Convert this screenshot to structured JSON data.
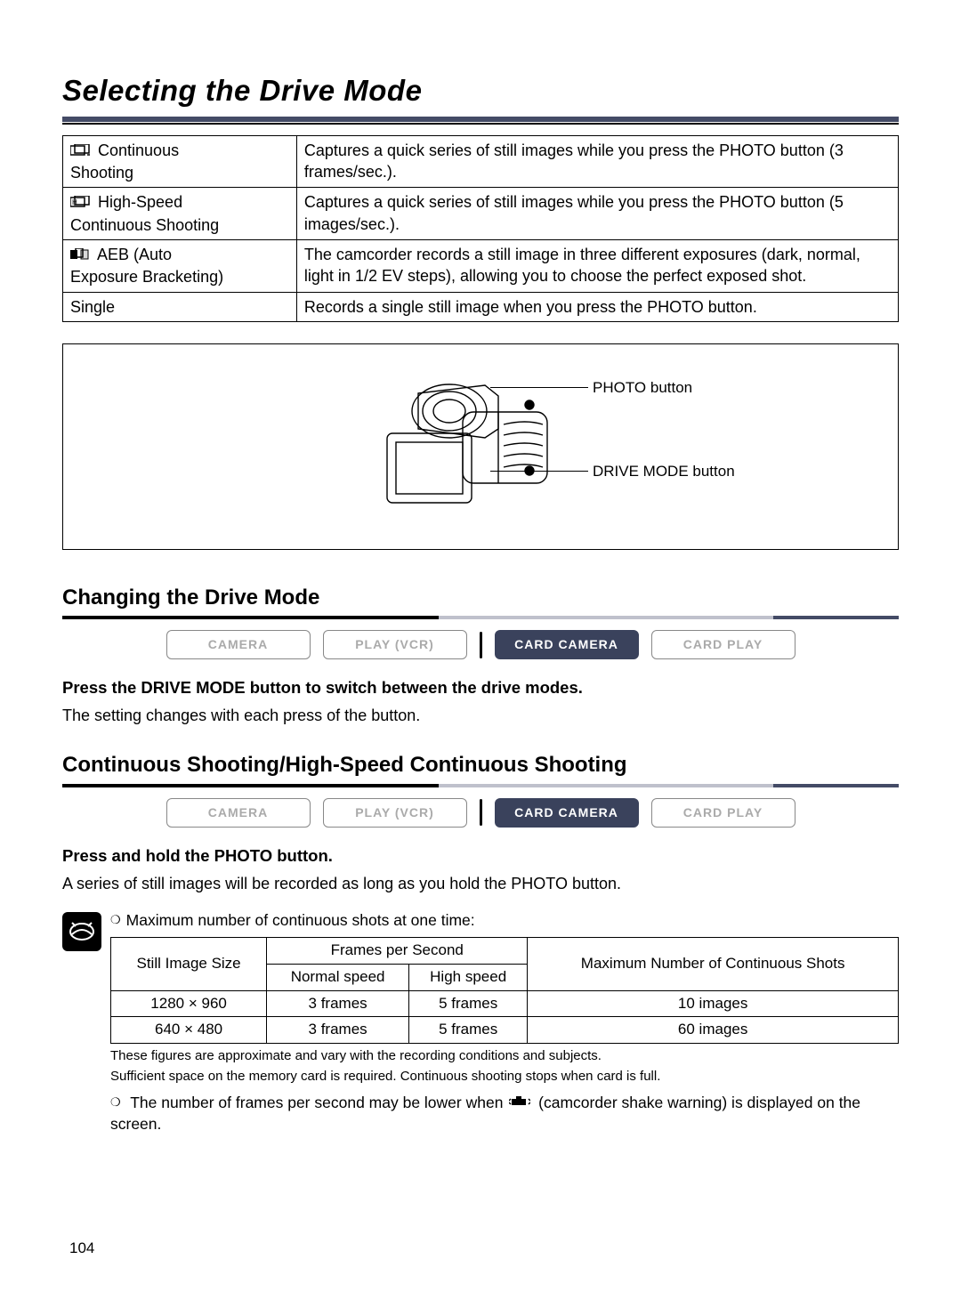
{
  "title": "Selecting the Drive Mode",
  "modes": [
    {
      "name_l1": "Continuous",
      "name_l2": "Shooting",
      "desc": "Captures a quick series of still images while you press the PHOTO button (3 frames/sec.)."
    },
    {
      "name_l1": "High-Speed",
      "name_l2": "Continuous Shooting",
      "desc": "Captures a quick series of still images while you press the PHOTO button (5 images/sec.)."
    },
    {
      "name_l1": "AEB (Auto",
      "name_l2": "Exposure Bracketing)",
      "desc": "The camcorder records a still image in three different exposures (dark, normal, light in 1/2 EV steps), allowing you to choose the perfect exposed shot."
    },
    {
      "name_l1": "Single",
      "name_l2": "",
      "desc": "Records a single still image when you press the PHOTO button."
    }
  ],
  "diagram": {
    "photo_btn": "PHOTO button",
    "drive_btn": "DRIVE MODE button"
  },
  "sections": {
    "change": {
      "heading": "Changing the Drive Mode",
      "instruction": "Press the DRIVE MODE button to switch between the drive modes.",
      "body": "The setting changes with each press of the button."
    },
    "continuous": {
      "heading": "Continuous Shooting/High-Speed Continuous Shooting",
      "instruction": "Press and hold the PHOTO button.",
      "body": "A series of still images will be recorded as long as you hold the PHOTO button."
    }
  },
  "pills": {
    "camera": "CAMERA",
    "play_vcr": "PLAY (VCR)",
    "card_camera": "CARD CAMERA",
    "card_play": "CARD PLAY"
  },
  "note": {
    "intro": "Maximum number of continuous shots at one time:",
    "table": {
      "h_size": "Still Image Size",
      "h_fps": "Frames per Second",
      "h_normal": "Normal speed",
      "h_high": "High speed",
      "h_max": "Maximum Number of Continuous Shots",
      "rows": [
        {
          "size": "1280 × 960",
          "normal": "3 frames",
          "high": "5 frames",
          "max": "10 images"
        },
        {
          "size": "640 × 480",
          "normal": "3 frames",
          "high": "5 frames",
          "max": "60 images"
        }
      ]
    },
    "fine1": "These figures are approximate and vary with the recording conditions and subjects.",
    "fine2": "Sufficient space on the memory card is required. Continuous shooting stops when card is full.",
    "shake_pre": "The number of frames per second may be lower when ",
    "shake_post": " (camcorder shake warning) is displayed on the screen."
  },
  "page_number": "104"
}
